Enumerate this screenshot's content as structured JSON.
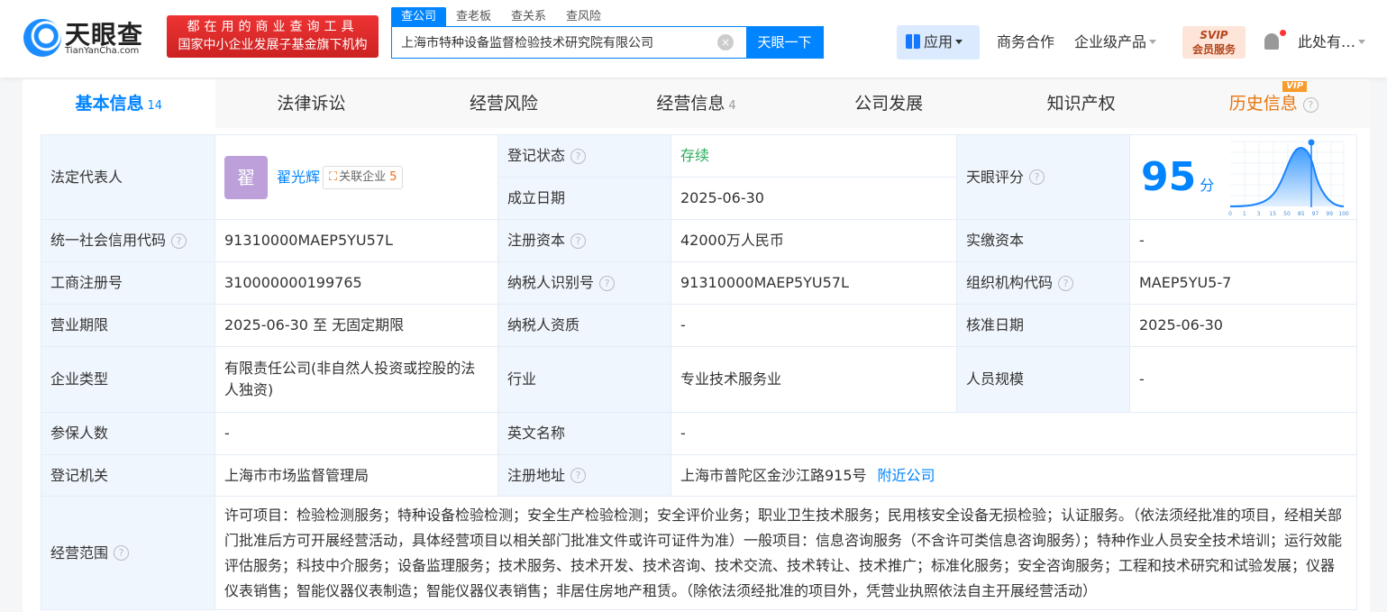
{
  "header": {
    "logo_name": "天眼查",
    "logo_domain": "TianYanCha.com",
    "slogan_line1": "都在用的商业查询工具",
    "slogan_line2": "国家中小企业发展子基金旗下机构",
    "search_tabs": [
      "查公司",
      "查老板",
      "查关系",
      "查风险"
    ],
    "search_value": "上海市特种设备监督检验技术研究院有限公司",
    "search_button": "天眼一下",
    "nav": {
      "apps": "应用",
      "business": "商务合作",
      "enterprise": "企业级产品",
      "svip_top": "SVIP",
      "svip_bottom": "会员服务",
      "user": "此处有…"
    }
  },
  "tabs": [
    {
      "label": "基本信息",
      "count": "14"
    },
    {
      "label": "法律诉讼"
    },
    {
      "label": "经营风险"
    },
    {
      "label": "经营信息",
      "count": "4"
    },
    {
      "label": "公司发展"
    },
    {
      "label": "知识产权"
    },
    {
      "label": "历史信息",
      "badge": "VIP"
    }
  ],
  "info": {
    "legal_rep_label": "法定代表人",
    "legal_rep_avatar": "翟",
    "legal_rep_name": "翟光辉",
    "related_label": "关联企业",
    "related_count": "5",
    "status_label": "登记状态",
    "status": "存续",
    "founded_label": "成立日期",
    "founded": "2025-06-30",
    "score_label": "天眼评分",
    "score": "95",
    "score_unit": "分",
    "score_ticks": [
      "0",
      "1",
      "3",
      "15",
      "50",
      "85",
      "97",
      "99",
      "100"
    ],
    "credit_label": "统一社会信用代码",
    "credit": "91310000MAEP5YU57L",
    "capital_label": "注册资本",
    "capital": "42000万人民币",
    "paid_label": "实缴资本",
    "paid": "-",
    "regno_label": "工商注册号",
    "regno": "310000000199765",
    "taxid_label": "纳税人识别号",
    "taxid": "91310000MAEP5YU57L",
    "org_label": "组织机构代码",
    "org": "MAEP5YU5-7",
    "term_label": "营业期限",
    "term": "2025-06-30 至 无固定期限",
    "taxq_label": "纳税人资质",
    "taxq": "-",
    "approve_label": "核准日期",
    "approve": "2025-06-30",
    "type_label": "企业类型",
    "type": "有限责任公司(非自然人投资或控股的法人独资)",
    "industry_label": "行业",
    "industry": "专业技术服务业",
    "staff_label": "人员规模",
    "staff": "-",
    "insured_label": "参保人数",
    "insured": "-",
    "en_label": "英文名称",
    "en": "-",
    "authority_label": "登记机关",
    "authority": "上海市市场监督管理局",
    "address_label": "注册地址",
    "address": "上海市普陀区金沙江路915号",
    "nearby": "附近公司",
    "scope_label": "经营范围",
    "scope": "许可项目：检验检测服务；特种设备检验检测；安全生产检验检测；安全评价业务；职业卫生技术服务；民用核安全设备无损检验；认证服务。（依法须经批准的项目，经相关部门批准后方可开展经营活动，具体经营项目以相关部门批准文件或许可证件为准）一般项目：信息咨询服务（不含许可类信息咨询服务）；特种作业人员安全技术培训；运行效能评估服务；科技中介服务；设备监理服务；技术服务、技术开发、技术咨询、技术交流、技术转让、技术推广；标准化服务；安全咨询服务；工程和技术研究和试验发展；仪器仪表销售；智能仪器仪表制造；智能仪器仪表销售；非居住房地产租赁。（除依法须经批准的项目外，凭营业执照依法自主开展经营活动）"
  }
}
